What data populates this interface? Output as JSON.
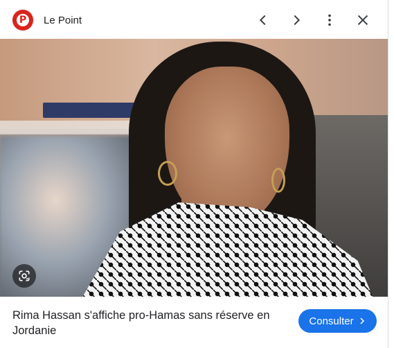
{
  "header": {
    "source_name": "Le Point",
    "logo_letter": "P",
    "buttons": {
      "previous": "chevron-left-icon",
      "next": "chevron-right-icon",
      "more": "more-vert-icon",
      "close": "close-icon"
    }
  },
  "image": {
    "lens_icon": "google-lens-icon"
  },
  "caption": {
    "title": "Rima Hassan s'affiche pro-Hamas sans réserve en Jordanie"
  },
  "actions": {
    "visit_label": "Consulter",
    "visit_icon": "chevron-right-icon"
  },
  "colors": {
    "brand_red": "#d9241c",
    "accent_blue": "#1a73e8",
    "text_primary": "#202124"
  }
}
